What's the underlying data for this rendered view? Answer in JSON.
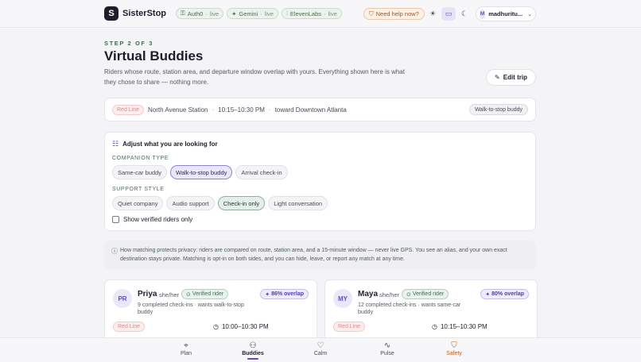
{
  "header": {
    "logo_letter": "S",
    "brand": "SisterStop",
    "integrations": [
      {
        "name": "Auth0",
        "status": "live"
      },
      {
        "name": "Gemini",
        "status": "live"
      },
      {
        "name": "ElevenLabs",
        "status": "live"
      }
    ],
    "help_label": "Need help now?",
    "user_initial": "M",
    "user_name": "madhuritu..."
  },
  "page": {
    "step": "STEP 2 OF 3",
    "title": "Virtual Buddies",
    "description": "Riders whose route, station area, and departure window overlap with yours. Everything shown here is what they chose to share — nothing more.",
    "edit_trip_label": "Edit trip"
  },
  "route": {
    "line": "Red Line",
    "station": "North Avenue Station",
    "window": "10:15–10:30 PM",
    "direction": "toward Downtown Atlanta",
    "mode": "Walk-to-stop buddy"
  },
  "preferences": {
    "heading": "Adjust what you are looking for",
    "companion_label": "COMPANION TYPE",
    "companion_options": [
      "Same-car buddy",
      "Walk-to-stop buddy",
      "Arrival check-in"
    ],
    "companion_selected": "Walk-to-stop buddy",
    "support_label": "SUPPORT STYLE",
    "support_options": [
      "Quiet company",
      "Audio support",
      "Check-in only",
      "Light conversation"
    ],
    "support_selected": "Check-in only",
    "verified_only_label": "Show verified riders only",
    "verified_only_checked": false
  },
  "privacy_note": "How matching protects privacy: riders are compared on route, station area, and a 15-minute window — never live GPS. You see an alias, and your own exact destination stays private. Matching is opt-in on both sides, and you can hide, leave, or report any match at any time.",
  "buddies": [
    {
      "initials": "PR",
      "name": "Priya",
      "pronouns": "she/her",
      "verified_label": "Verified rider",
      "overlap": "86% overlap",
      "meta": "9 completed check-ins · wants walk-to-stop buddy",
      "line": "Red Line",
      "time": "10:00–10:30 PM"
    },
    {
      "initials": "MY",
      "name": "Maya",
      "pronouns": "she/her",
      "verified_label": "Verified rider",
      "overlap": "80% overlap",
      "meta": "12 completed check-ins · wants same-car buddy",
      "line": "Red Line",
      "time": "10:15–10:30 PM"
    }
  ],
  "nav": {
    "items": [
      {
        "label": "Plan",
        "icon": "map-pin-icon"
      },
      {
        "label": "Buddies",
        "icon": "users-icon"
      },
      {
        "label": "Calm",
        "icon": "heart-icon"
      },
      {
        "label": "Pulse",
        "icon": "activity-icon"
      },
      {
        "label": "Safety",
        "icon": "shield-icon"
      }
    ],
    "active": "Buddies"
  },
  "colors": {
    "accent": "#5b4fb5",
    "green": "#3f6b57",
    "red_line": "#d98a8a",
    "safety": "#b0612a"
  }
}
